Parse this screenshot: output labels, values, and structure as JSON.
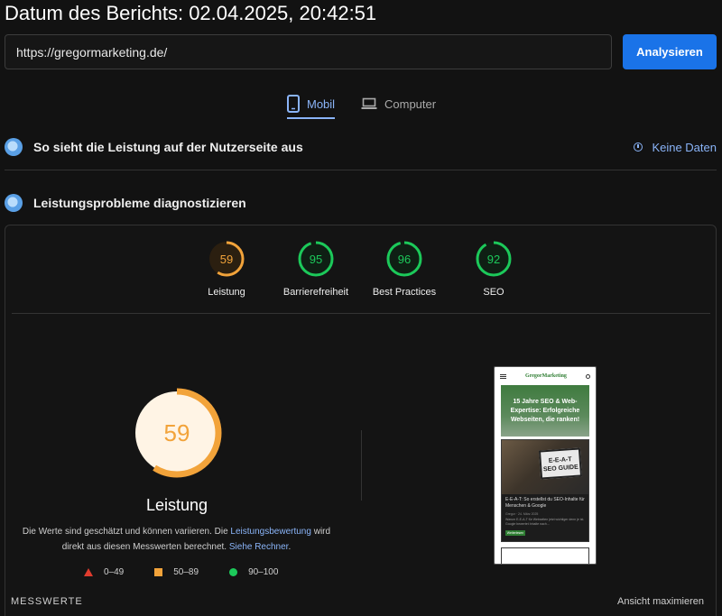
{
  "report": {
    "title": "Datum des Berichts: 02.04.2025, 20:42:51"
  },
  "search": {
    "url": "https://gregormarketing.de/",
    "button_label": "Analysieren"
  },
  "tabs": [
    {
      "label": "Mobil",
      "icon": "smartphone-icon",
      "active": true
    },
    {
      "label": "Computer",
      "icon": "laptop-icon",
      "active": false
    }
  ],
  "field_data": {
    "title": "So sieht die Leistung auf der Nutzerseite aus",
    "no_data_label": "Keine Daten",
    "icon": "info-icon"
  },
  "diagnostics": {
    "title": "Leistungsprobleme diagnostizieren"
  },
  "scores": [
    {
      "label": "Leistung",
      "value": 59,
      "color": "#f2a33a"
    },
    {
      "label": "Barrierefreiheit",
      "value": 95,
      "color": "#1cc95a"
    },
    {
      "label": "Best Practices",
      "value": 96,
      "color": "#1cc95a"
    },
    {
      "label": "SEO",
      "value": 92,
      "color": "#1cc95a"
    }
  ],
  "performance": {
    "value": 59,
    "title": "Leistung",
    "desc_part1": "Die Werte sind geschätzt und können variieren. Die ",
    "desc_link1": "Leistungsbewertung",
    "desc_part2": " wird direkt aus diesen Messwerten berechnet. ",
    "desc_link2": "Siehe Rechner",
    "desc_part3": "."
  },
  "legend": [
    {
      "range": "0–49",
      "shape": "triangle",
      "color": "#e03c2e"
    },
    {
      "range": "50–89",
      "shape": "square",
      "color": "#f2a33a"
    },
    {
      "range": "90–100",
      "shape": "circle",
      "color": "#1cc95a"
    }
  ],
  "screenshot": {
    "brand": "GregorMarketing",
    "hero_text": "15 Jahre SEO & Web-Expertise: Erfolgreiche Webseiten, die ranken!",
    "card_image_text": "E-E-A-T SEO GUIDE",
    "card_title": "E-E-A-T: So erstellst du SEO-Inhalte für Menschen & Google",
    "card_meta": "Gregor · 24. März 2025",
    "card_excerpt": "Warum E-E-A-T für Webseiten jetzt wichtiger denn je ist. Google bewertet Inhalte nach...",
    "card_button": "Weiterlesen"
  },
  "footer": {
    "metrics_label": "MESSWERTE",
    "expand_label": "Ansicht maximieren"
  }
}
